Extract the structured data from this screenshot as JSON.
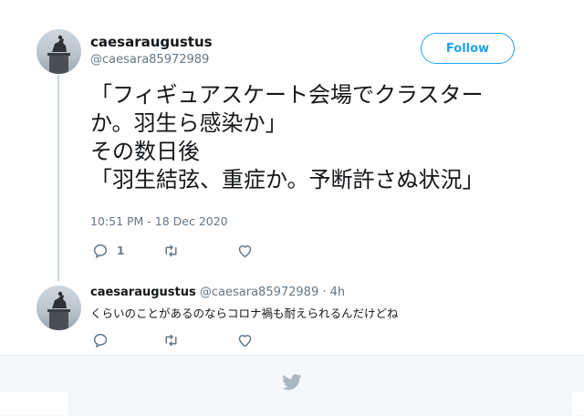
{
  "tweet": {
    "author_name": "caesaraugustus",
    "author_handle": "@caesara85972989",
    "follow_label": "Follow",
    "text_lines": [
      "「フィギュアスケート会場でクラスター",
      "か。羽生ら感染か」",
      "その数日後",
      "「羽生結弦、重症か。予断許さぬ状況」"
    ],
    "timestamp": "10:51 PM - 18 Dec 2020",
    "reply_count": "1"
  },
  "reply": {
    "author_name": "caesaraugustus",
    "author_handle": "@caesara85972989",
    "separator": "·",
    "age": "4h",
    "text": "くらいのことがあるのならコロナ禍も耐えられるんだけどね"
  },
  "icons": {
    "reply": "reply-icon",
    "retweet": "retweet-icon",
    "like": "heart-icon",
    "brand": "twitter-bird-icon"
  },
  "colors": {
    "accent": "#1da1f2",
    "muted": "#657786",
    "footer_bg": "#f5f8fa",
    "bird": "#aab8c2"
  }
}
